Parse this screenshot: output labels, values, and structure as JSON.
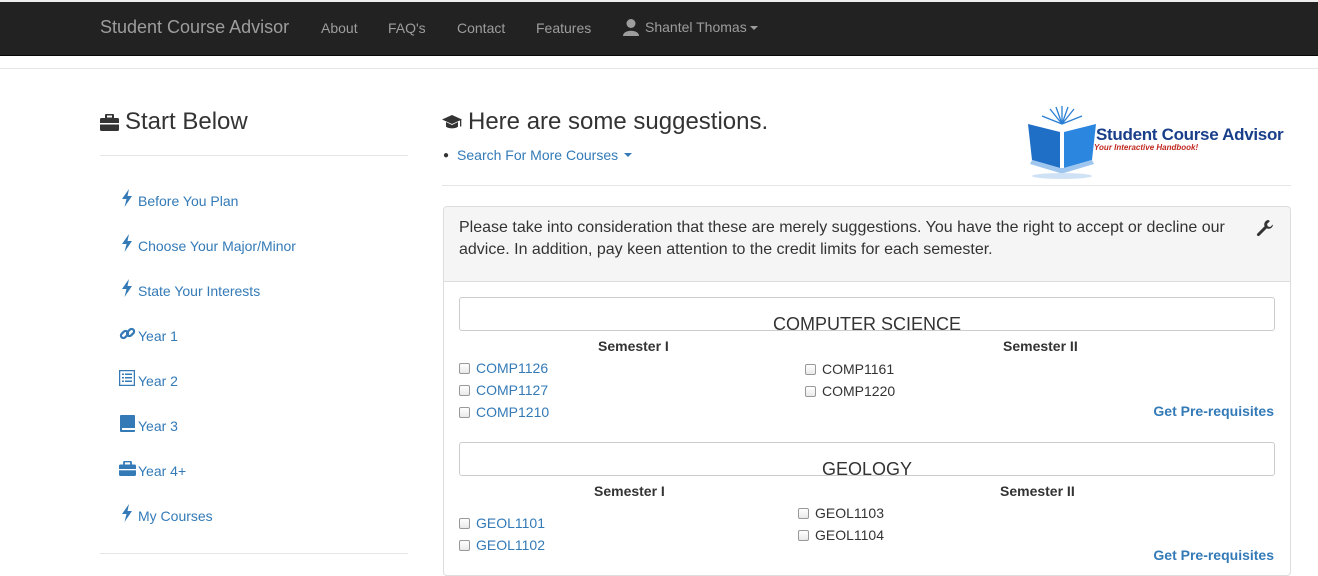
{
  "navbar": {
    "brand": "Student Course Advisor",
    "links": [
      "About",
      "FAQ's",
      "Contact",
      "Features"
    ],
    "user": "Shantel Thomas",
    "user_icon": "user-icon"
  },
  "sidebar": {
    "title": "Start Below",
    "title_icon": "briefcase-icon",
    "items": [
      {
        "label": "Before You Plan",
        "icon": "flash-icon"
      },
      {
        "label": "Choose Your Major/Minor",
        "icon": "flash-icon"
      },
      {
        "label": "State Your Interests",
        "icon": "flash-icon"
      },
      {
        "label": "Year 1",
        "icon": "link-icon"
      },
      {
        "label": "Year 2",
        "icon": "list-alt-icon"
      },
      {
        "label": "Year 3",
        "icon": "book-icon"
      },
      {
        "label": "Year 4+",
        "icon": "briefcase-icon"
      },
      {
        "label": "My Courses",
        "icon": "flash-icon"
      }
    ]
  },
  "main": {
    "title": "Here are some suggestions.",
    "title_icon": "education-icon",
    "search_link": "Search For More Courses",
    "logo": {
      "text": "Student Course Advisor",
      "tagline": "Your Interactive Handbook!"
    },
    "notice": "Please take into consideration that these are merely suggestions. You have the right to accept or decline our advice. In addition, pay keen attention to the credit limits for each semester.",
    "subjects": [
      {
        "name": "COMPUTER SCIENCE",
        "sem1_label": "Semester I",
        "sem2_label": "Semester II",
        "sem1": [
          "COMP1126",
          "COMP1127",
          "COMP1210"
        ],
        "sem2": [
          "COMP1161",
          "COMP1220"
        ],
        "prereq": "Get Pre-requisites"
      },
      {
        "name": "GEOLOGY",
        "sem1_label": "Semester I",
        "sem2_label": "Semester II",
        "sem1": [
          "GEOL1101",
          "GEOL1102"
        ],
        "sem2": [
          "GEOL1103",
          "GEOL1104"
        ],
        "prereq": "Get Pre-requisites"
      }
    ]
  },
  "colors": {
    "navbar": "#222222",
    "link": "#337ab7",
    "muted": "#9d9d9d"
  }
}
